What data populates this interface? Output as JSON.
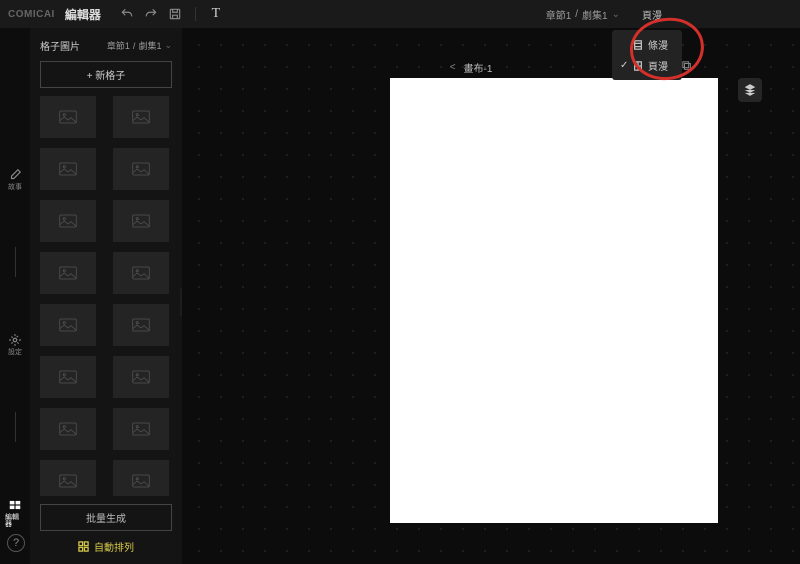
{
  "brand": "COMICAI",
  "app_title": "編輯器",
  "topbar": {
    "breadcrumb_chapter": "章節1",
    "breadcrumb_episode": "劇集1",
    "mode_button": "頁漫"
  },
  "mode_menu": {
    "item1": "條漫",
    "item2": "頁漫"
  },
  "leftrail": {
    "story": "故事",
    "setting": "設定",
    "editor": "編輯器"
  },
  "sidebar": {
    "title": "格子圖片",
    "crumb_chapter": "章節1",
    "crumb_episode": "劇集1",
    "add_button": "+ 新格子",
    "batch_button": "批量生成",
    "auto_arrange": "自動排列"
  },
  "canvas": {
    "title": "畫布-1"
  },
  "help": "?"
}
